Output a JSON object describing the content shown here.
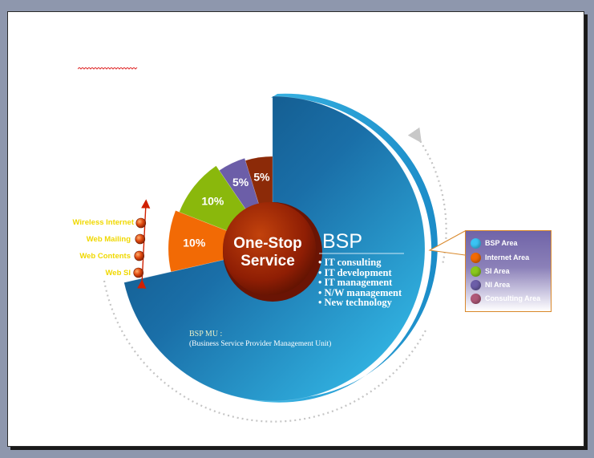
{
  "chart_data": {
    "type": "pie",
    "center_label_line1": "One-Stop",
    "center_label_line2": "Service",
    "slices": [
      {
        "name": "BSP Area",
        "value": 75,
        "color": "#2aa0d8"
      },
      {
        "name": "Web SI area",
        "value": 10,
        "label": "10%",
        "color": "#f26a05"
      },
      {
        "name": "SI Area",
        "value": 10,
        "label": "10%",
        "color": "#8ab80c"
      },
      {
        "name": "NI Area",
        "value": 5,
        "label": "5%",
        "color": "#6c5ea8"
      },
      {
        "name": "Consulting Area",
        "value": 5,
        "label": "5%",
        "color": "#8c2a08"
      }
    ]
  },
  "bsp": {
    "title": "BSP",
    "items": [
      "• IT consulting",
      "• IT development",
      "• IT management",
      "• N/W management",
      "• New technology"
    ],
    "mu_label": "BSP MU :",
    "mu_sub": "(Business Service Provider Management Unit)"
  },
  "web_items": [
    "Wireless Internet",
    "Web Mailing",
    "Web Contents",
    "Web SI"
  ],
  "legend": [
    {
      "label": "BSP Area",
      "color": "#3ac4f4"
    },
    {
      "label": "Internet Area",
      "color": "#f26a05"
    },
    {
      "label": "SI Area",
      "color": "#8ac81c"
    },
    {
      "label": "NI Area",
      "color": "#6c5ea8"
    },
    {
      "label": "Consulting Area",
      "color": "#b05878"
    }
  ]
}
